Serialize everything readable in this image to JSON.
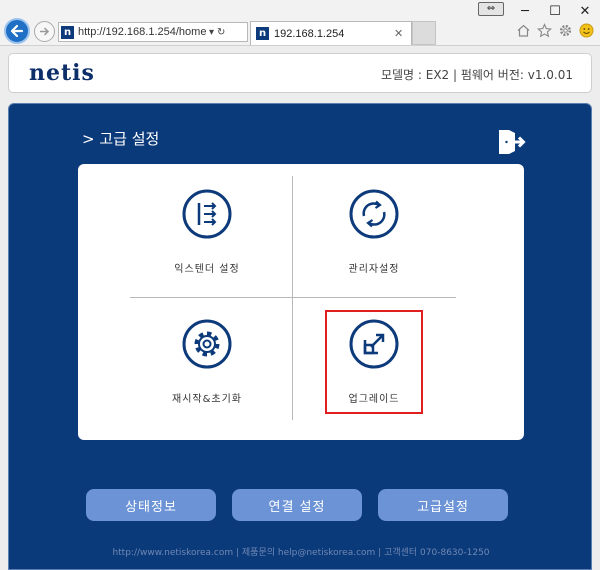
{
  "browser": {
    "address": "http://192.168.1.254/home.",
    "tab_title": "192.168.1.254",
    "favicon_letter": "n",
    "restore_glyph": "⇔",
    "win_minimize": "─",
    "win_maximize": "☐",
    "win_close": "✕",
    "addr_dropdown": "▾",
    "addr_refresh": "↻",
    "tab_close": "✕",
    "icons": [
      "back-arrow-icon",
      "forward-icon",
      "home-icon",
      "star-icon",
      "gear-icon",
      "smiley-icon"
    ]
  },
  "header": {
    "logo": "netis",
    "model_info": "모델명 : EX2 | 펌웨어 버전: v1.0.01"
  },
  "section": {
    "title": "> 고급 설정"
  },
  "tiles": [
    {
      "label": "익스텐더 설정",
      "icon": "extender-settings-icon"
    },
    {
      "label": "관리자설정",
      "icon": "admin-settings-icon"
    },
    {
      "label": "재시작&초기화",
      "icon": "reboot-reset-icon"
    },
    {
      "label": "업그레이드",
      "icon": "upgrade-icon"
    }
  ],
  "nav": {
    "status": "상태정보",
    "connection": "연결 설정",
    "advanced": "고급설정"
  },
  "footer": {
    "text": "http://www.netiskorea.com | 제품문의 help@netiskorea.com | 고객센터 070-8630-1250"
  },
  "colors": {
    "main_bg": "#0b3a7b",
    "nav_button": "#6b93d6",
    "highlight": "#e02020",
    "logo": "#0c2f6a"
  }
}
